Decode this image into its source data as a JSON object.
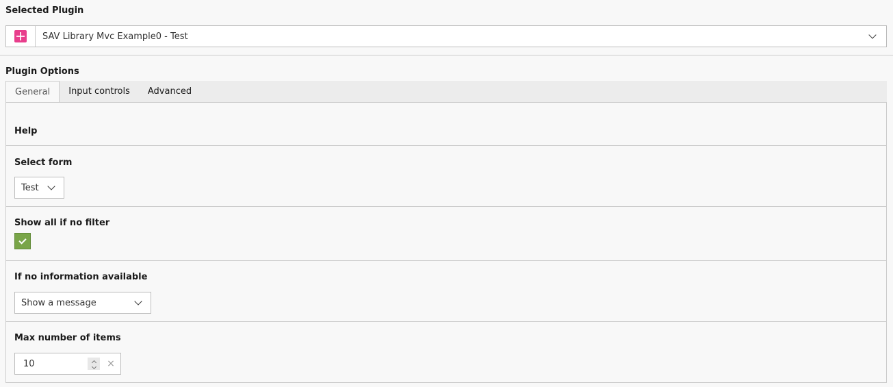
{
  "selected_plugin": {
    "label": "Selected Plugin",
    "value": "SAV Library Mvc Example0 - Test",
    "icon": "plugin-icon",
    "icon_color": "#e83e8c"
  },
  "plugin_options": {
    "label": "Plugin Options",
    "tabs": [
      {
        "label": "General",
        "active": true
      },
      {
        "label": "Input controls",
        "active": false
      },
      {
        "label": "Advanced",
        "active": false
      }
    ]
  },
  "fields": {
    "help": {
      "label": "Help"
    },
    "select_form": {
      "label": "Select form",
      "value": "Test"
    },
    "show_all": {
      "label": "Show all if no filter",
      "checked": true,
      "color": "#79a548"
    },
    "no_info": {
      "label": "If no information available",
      "value": "Show a message"
    },
    "max_items": {
      "label": "Max number of items",
      "value": "10",
      "clear_glyph": "×"
    }
  }
}
